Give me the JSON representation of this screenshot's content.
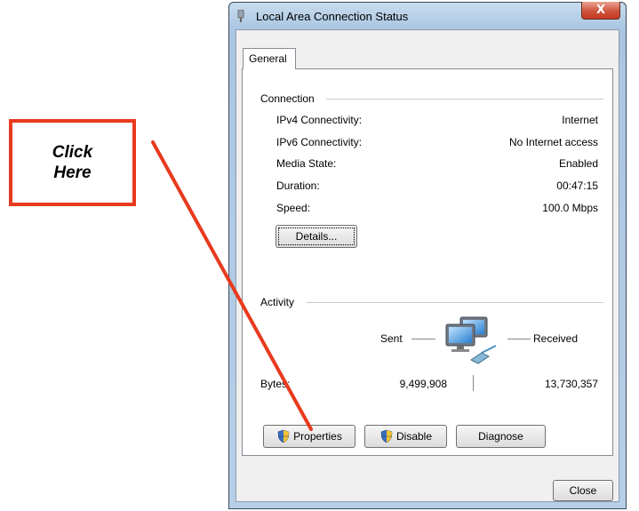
{
  "callout": {
    "text": "Click\nHere",
    "color": "#e83a1e"
  },
  "window": {
    "title": "Local Area Connection Status",
    "close_glyph": "X",
    "tab": "General",
    "connection": {
      "heading": "Connection",
      "rows": [
        {
          "label": "IPv4 Connectivity:",
          "value": "Internet"
        },
        {
          "label": "IPv6 Connectivity:",
          "value": "No Internet access"
        },
        {
          "label": "Media State:",
          "value": "Enabled"
        },
        {
          "label": "Duration:",
          "value": "00:47:15"
        },
        {
          "label": "Speed:",
          "value": "100.0 Mbps"
        }
      ],
      "details_button": "Details..."
    },
    "activity": {
      "heading": "Activity",
      "sent_label": "Sent",
      "received_label": "Received",
      "bytes_label": "Bytes:",
      "bytes_sent": "9,499,908",
      "bytes_received": "13,730,357",
      "icon": "network-computers-icon"
    },
    "buttons": {
      "properties": "Properties",
      "disable": "Disable",
      "diagnose": "Diagnose",
      "close": "Close"
    }
  }
}
